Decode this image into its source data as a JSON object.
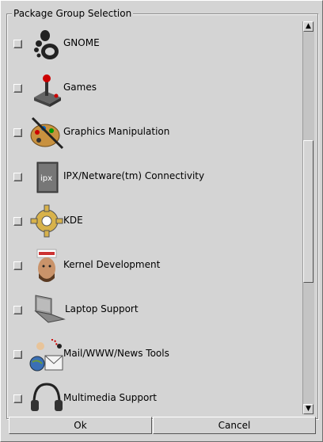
{
  "group_title": "Package Group Selection",
  "packages": [
    {
      "label": "GNOME",
      "icon": "gnome-foot-icon",
      "checked": false
    },
    {
      "label": "Games",
      "icon": "joystick-icon",
      "checked": false
    },
    {
      "label": "Graphics Manipulation",
      "icon": "paint-palette-icon",
      "checked": false
    },
    {
      "label": "IPX/Netware(tm) Connectivity",
      "icon": "ipx-server-icon",
      "checked": false
    },
    {
      "label": "KDE",
      "icon": "kde-gear-icon",
      "checked": false
    },
    {
      "label": "Kernel Development",
      "icon": "kernel-developer-icon",
      "checked": false
    },
    {
      "label": "Laptop Support",
      "icon": "laptop-icon",
      "checked": false
    },
    {
      "label": "Mail/WWW/News Tools",
      "icon": "mail-web-icon",
      "checked": false
    },
    {
      "label": "Multimedia Support",
      "icon": "headphones-icon",
      "checked": false
    }
  ],
  "buttons": {
    "ok": "Ok",
    "cancel": "Cancel"
  },
  "scrollbar": {
    "up": "▲",
    "down": "▼"
  }
}
